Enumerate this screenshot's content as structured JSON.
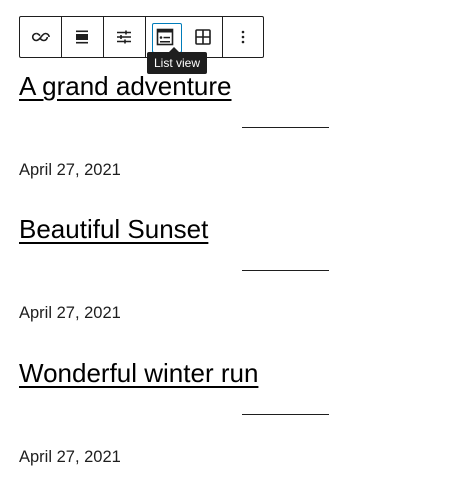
{
  "toolbar": {
    "buttons": [
      {
        "icon": "loop-icon"
      },
      {
        "icon": "align-icon"
      },
      {
        "icon": "sliders-icon"
      },
      {
        "icon": "list-view-icon"
      },
      {
        "icon": "grid-view-icon"
      },
      {
        "icon": "more-options-icon"
      }
    ],
    "tooltip": "List view"
  },
  "posts": [
    {
      "title": "A grand adventure",
      "date": "April 27, 2021"
    },
    {
      "title": "Beautiful Sunset",
      "date": "April 27, 2021"
    },
    {
      "title": "Wonderful winter run",
      "date": "April 27, 2021"
    }
  ],
  "colors": {
    "accent": "#007cba",
    "text": "#1e1e1e",
    "tooltip_bg": "#1e1e1e"
  }
}
